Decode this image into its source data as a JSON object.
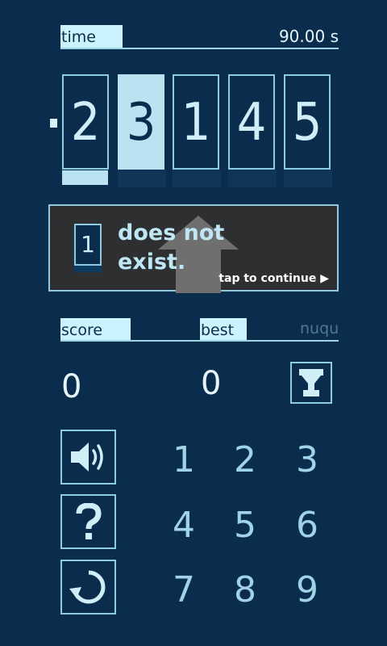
{
  "header": {
    "time_label": "time",
    "time_value": "90.00 s"
  },
  "digits": {
    "items": [
      "2",
      "3",
      "1",
      "4",
      "5"
    ],
    "active_index": 1
  },
  "message": {
    "digit": "1",
    "text_line1": "does not",
    "text_line2": "exist.",
    "continue_label": "tap to continue ▶"
  },
  "stats": {
    "score_label": "score",
    "best_label": "best",
    "player_name": "nuqu",
    "score_value": "0",
    "best_value": "0"
  },
  "keypad": {
    "keys": [
      "1",
      "2",
      "3",
      "4",
      "5",
      "6",
      "7",
      "8",
      "9"
    ]
  },
  "icons": {
    "leaderboard": "trophy-icon",
    "sound": "speaker-icon",
    "help": "help-icon",
    "restart": "restart-icon"
  },
  "colors": {
    "background": "#0b2d4d",
    "accent_light": "#cbf2ff",
    "border": "#8ccbe0",
    "panel": "#2e2f31"
  }
}
